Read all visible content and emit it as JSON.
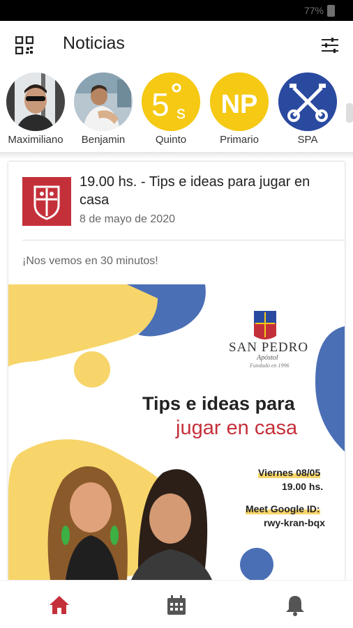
{
  "status_bar": {
    "battery_text": "77%"
  },
  "app_bar": {
    "title": "Noticias",
    "left_icon": "qr-code-icon",
    "right_icon": "filter-sliders-icon"
  },
  "stories": [
    {
      "label": "Maximiliano"
    },
    {
      "label": "Benjamin"
    },
    {
      "label": "Quinto",
      "badge": "5°s",
      "bg": "#f5c914"
    },
    {
      "label": "Primario",
      "badge": "NP",
      "bg": "#f5c914"
    },
    {
      "label": "SPA",
      "bg": "#2a4aa0"
    }
  ],
  "post": {
    "title": "19.00 hs. - Tips e ideas para jugar en casa",
    "date": "8 de mayo de 2020",
    "subtitle": "¡Nos vemos en 30 minutos!",
    "poster": {
      "brand_name": "SAN PEDRO",
      "brand_sub": "Apóstol",
      "brand_tag": "Fundado en 1996",
      "headline_1": "Tips e ideas para",
      "headline_2": "jugar en casa",
      "day": "Viernes 08/05",
      "time": "19.00 hs.",
      "meet_label": "Meet Google ID:",
      "meet_id": "rwy-kran-bqx"
    }
  },
  "bottom_nav": [
    {
      "icon": "home-icon",
      "active": true
    },
    {
      "icon": "calendar-icon",
      "active": false
    },
    {
      "icon": "bell-icon",
      "active": false
    }
  ],
  "colors": {
    "brand_red": "#c4303a",
    "yellow": "#f5c914",
    "blue": "#2a4aa0",
    "poster_yellow": "#f7d56a",
    "poster_blue": "#4a6fb5"
  }
}
